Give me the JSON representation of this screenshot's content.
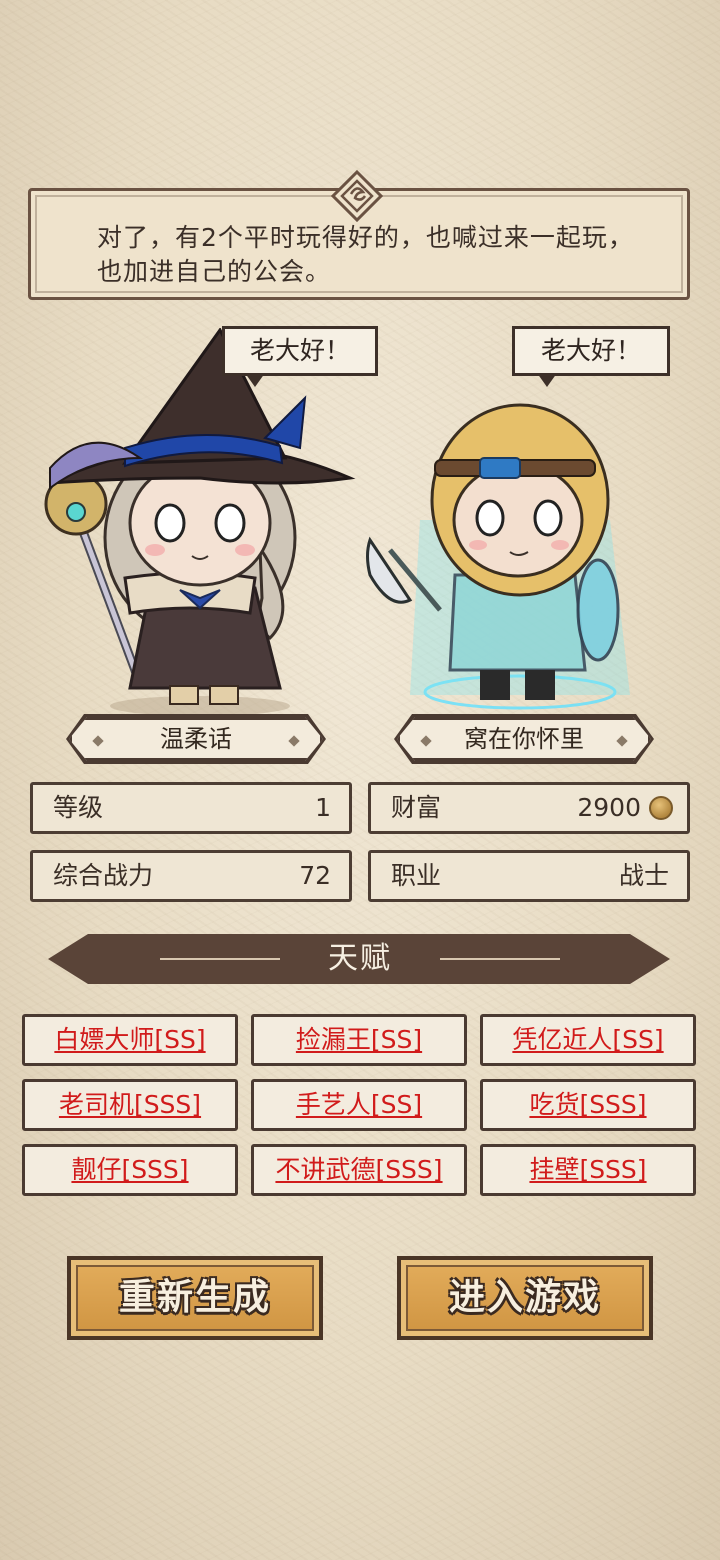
{
  "dialog": {
    "line1": "对了，有2个平时玩得好的，也喊过来一起玩，",
    "line2": "也加进自己的公会。"
  },
  "characters": [
    {
      "greeting": "老大好！",
      "name": "温柔话",
      "portrait": "witch-mage-character"
    },
    {
      "greeting": "老大好！",
      "name": "窝在你怀里",
      "portrait": "warrior-character-ghost"
    }
  ],
  "stats": {
    "level_label": "等级",
    "level_value": "1",
    "wealth_label": "财富",
    "wealth_value": "2900",
    "wealth_icon": "gold-coin-icon",
    "power_label": "综合战力",
    "power_value": "72",
    "class_label": "职业",
    "class_value": "战士"
  },
  "talents": {
    "title": "天赋",
    "items": [
      "白嫖大师[SS]",
      "捡漏王[SS]",
      "凭亿近人[SS]",
      "老司机[SSS]",
      "手艺人[SS]",
      "吃货[SSS]",
      "靓仔[SSS]",
      "不讲武德[SSS]",
      "挂壁[SSS]"
    ]
  },
  "buttons": {
    "regenerate": "重新生成",
    "enter_game": "进入游戏"
  },
  "colors": {
    "talent_text": "#d11b1b",
    "button_fill": "#d9a04c",
    "banner": "#5a4438",
    "paper": "#ece1cb"
  }
}
